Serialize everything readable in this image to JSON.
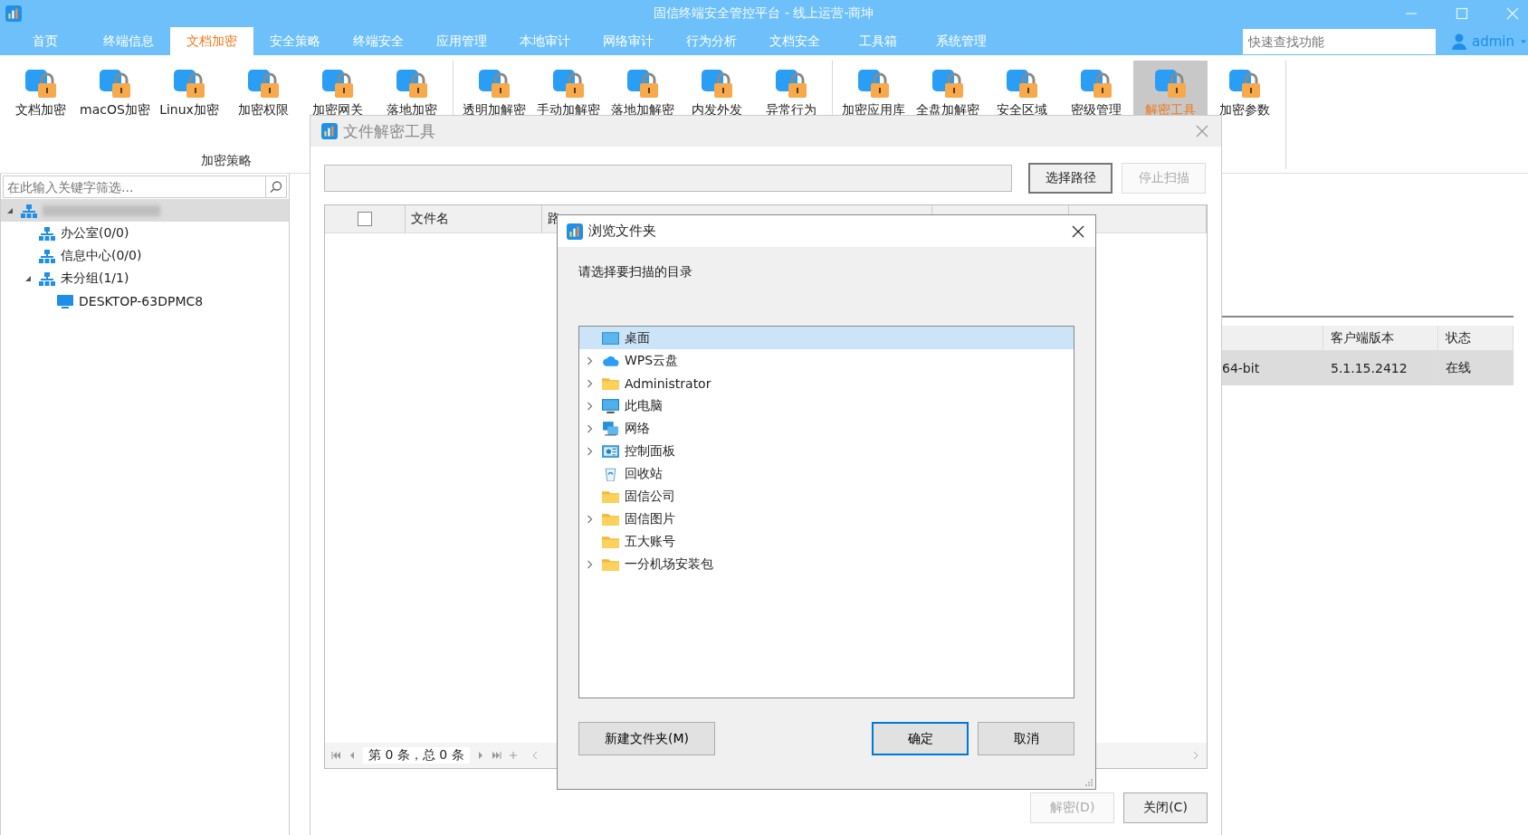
{
  "window": {
    "title": "固信终端安全管控平台 - 线上运营-商坤"
  },
  "tabs": [
    {
      "label": "首页",
      "selected": false
    },
    {
      "label": "终端信息",
      "selected": false
    },
    {
      "label": "文档加密",
      "selected": true
    },
    {
      "label": "安全策略",
      "selected": false
    },
    {
      "label": "终端安全",
      "selected": false
    },
    {
      "label": "应用管理",
      "selected": false
    },
    {
      "label": "本地审计",
      "selected": false
    },
    {
      "label": "网络审计",
      "selected": false
    },
    {
      "label": "行为分析",
      "selected": false
    },
    {
      "label": "文档安全",
      "selected": false
    },
    {
      "label": "工具箱",
      "selected": false
    },
    {
      "label": "系统管理",
      "selected": false
    }
  ],
  "quick_search": {
    "placeholder": "快速查找功能"
  },
  "user": {
    "name": "admin"
  },
  "ribbon": [
    {
      "label": "加密策略",
      "items": [
        {
          "label": "文档加密",
          "selected": false
        },
        {
          "label": "macOS加密",
          "selected": false
        },
        {
          "label": "Linux加密",
          "selected": false
        },
        {
          "label": "加密权限",
          "selected": false
        },
        {
          "label": "加密网关",
          "selected": false
        },
        {
          "label": "落地加密",
          "selected": false
        }
      ]
    },
    {
      "items": [
        {
          "label": "透明加解密",
          "selected": false
        },
        {
          "label": "手动加解密",
          "selected": false
        },
        {
          "label": "落地加解密",
          "selected": false
        },
        {
          "label": "内发外发",
          "selected": false
        },
        {
          "label": "异常行为",
          "selected": false
        }
      ]
    },
    {
      "items": [
        {
          "label": "加密应用库",
          "selected": false
        },
        {
          "label": "全盘加解密",
          "selected": false
        },
        {
          "label": "安全区域",
          "selected": false
        },
        {
          "label": "密级管理",
          "selected": false
        },
        {
          "label": "解密工具",
          "selected": true
        },
        {
          "label": "加密参数",
          "selected": false
        }
      ]
    }
  ],
  "sidebar": {
    "filter": {
      "placeholder": "在此输入关键字筛选..."
    },
    "tree": [
      {
        "redacted": true,
        "kind": "group",
        "expanded": true,
        "selected": true,
        "children": [
          {
            "label": "办公室(0/0)",
            "kind": "group",
            "selected": false
          },
          {
            "label": "信息中心(0/0)",
            "kind": "group",
            "selected": false
          },
          {
            "label": "未分组(1/1)",
            "kind": "group",
            "expanded": true,
            "selected": false,
            "children": [
              {
                "label": "DESKTOP-63DPMC8",
                "kind": "computer",
                "selected": false
              }
            ]
          }
        ]
      }
    ]
  },
  "table": {
    "columns": [
      {
        "kind": "blank"
      },
      {
        "kind": "text",
        "label": "客户端版本"
      },
      {
        "kind": "text",
        "label": "状态"
      }
    ],
    "rows": [
      {
        "cells": [
          "64-bit",
          "5.1.15.2412",
          "在线"
        ],
        "selected": true
      }
    ]
  },
  "decrypt_dialog": {
    "title": "文件解密工具",
    "buttons": [
      {
        "label": "选择路径",
        "disabled": false
      },
      {
        "label": "停止扫描",
        "disabled": true
      }
    ],
    "header_checkbox": {
      "checked": false
    },
    "columns": [
      {
        "label": "文件名"
      },
      {
        "label": "路"
      }
    ],
    "pager": "第 0 条，总 0 条",
    "footer_buttons": [
      {
        "label": "解密(D)",
        "disabled": true
      },
      {
        "label": "关闭(C)",
        "disabled": false
      }
    ]
  },
  "browse_dialog": {
    "title": "浏览文件夹",
    "prompt": "请选择要扫描的目录",
    "items": [
      {
        "label": "桌面",
        "kind": "desktop",
        "expander": false,
        "selected": true
      },
      {
        "label": "WPS云盘",
        "kind": "cloud",
        "expander": true,
        "selected": false
      },
      {
        "label": "Administrator",
        "kind": "folder",
        "expander": true,
        "selected": false
      },
      {
        "label": "此电脑",
        "kind": "computer",
        "expander": true,
        "selected": false
      },
      {
        "label": "网络",
        "kind": "network",
        "expander": true,
        "selected": false
      },
      {
        "label": "控制面板",
        "kind": "panel",
        "expander": true,
        "selected": false
      },
      {
        "label": "回收站",
        "kind": "bin",
        "expander": false,
        "selected": false
      },
      {
        "label": "固信公司",
        "kind": "folder",
        "expander": false,
        "selected": false
      },
      {
        "label": "固信图片",
        "kind": "folder",
        "expander": true,
        "selected": false
      },
      {
        "label": "五大账号",
        "kind": "folder",
        "expander": false,
        "selected": false
      },
      {
        "label": "一分机场安装包",
        "kind": "folder",
        "expander": true,
        "selected": false
      }
    ],
    "buttons": [
      {
        "label": "新建文件夹(M)",
        "default": false
      },
      {
        "label": "确定",
        "default": true
      },
      {
        "label": "取消",
        "default": false
      }
    ]
  }
}
